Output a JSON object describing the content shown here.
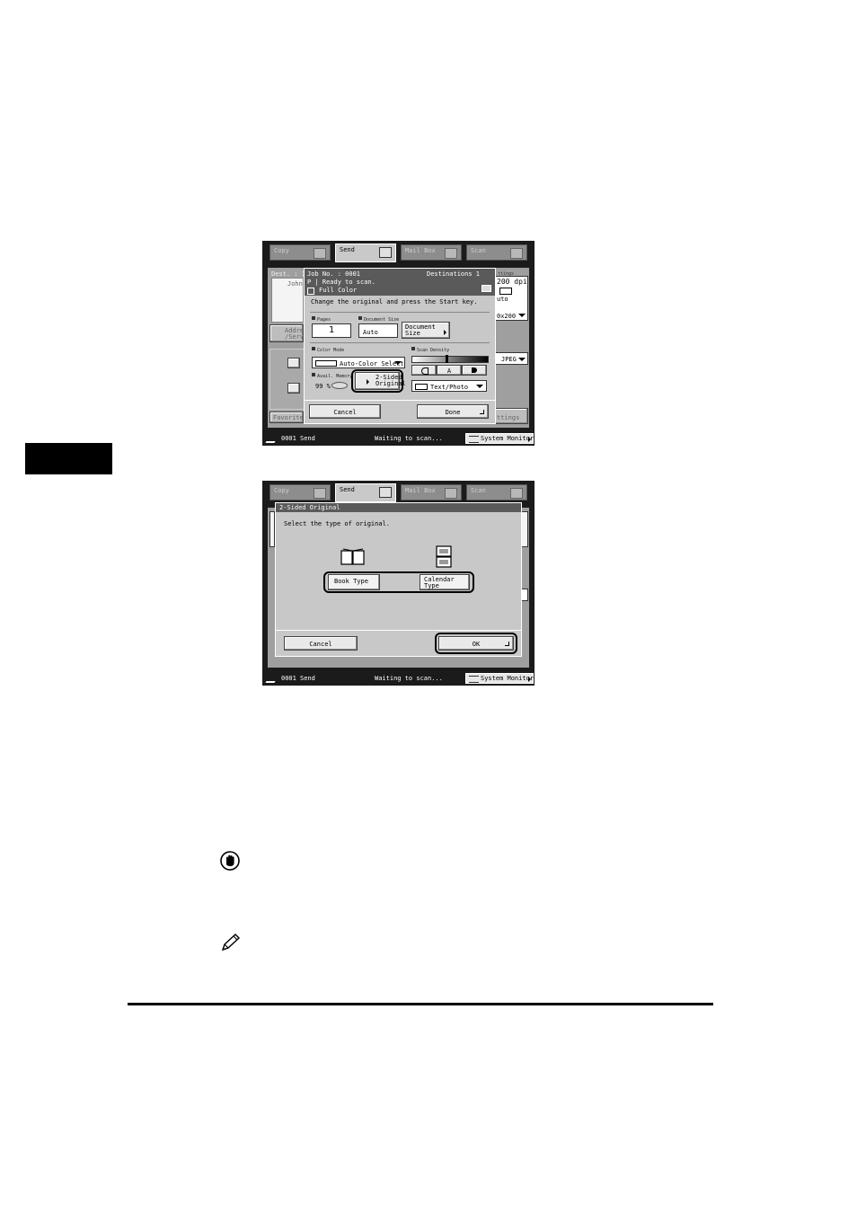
{
  "page": {
    "tab_color": "#000000"
  },
  "screen1": {
    "tabs": [
      "Copy",
      "Send",
      "Mail Box",
      "Scan"
    ],
    "bg_fragments": {
      "dest": "Dest. :  1",
      "dest_name": "John",
      "addr": "Addre",
      "serv": "/Serv",
      "favorites": "Favorites",
      "settings": "ttings",
      "dpi": "200 dpi",
      "auto": "uto",
      "res": "0x200",
      "jpeg": "JPEG",
      "ttings_btn": "ttings"
    },
    "dialog": {
      "job_no": "Job No. :  0001",
      "destinations": "Destinations  1",
      "status": "P  |  Ready to scan.",
      "color": "Full Color",
      "instruction": "Change the original and press the Start key.",
      "pages_label": "Pages",
      "pages_value": "1",
      "docsize_label": "Document Size",
      "docsize_value": "Auto",
      "docsize_button_1": "Document",
      "docsize_button_2": "Size",
      "color_mode_label": "Color Mode",
      "color_mode_value": "Auto-Color Select",
      "avail_memory_label": "Avail. Memory",
      "memory_value": "99 %",
      "two_sided_1": "2-Sided",
      "two_sided_2": "Original",
      "scan_density_label": "Scan Density",
      "density_center": "A",
      "image_type_value": "Text/Photo",
      "cancel": "Cancel",
      "done": "Done"
    },
    "status_bar": {
      "job": "0001",
      "mode": "Send",
      "message": "Waiting to scan...",
      "system_monitor": "System Monitor"
    }
  },
  "screen2": {
    "tabs": [
      "Copy",
      "Send",
      "Mail Box",
      "Scan"
    ],
    "dialog": {
      "title": "2-Sided Original",
      "instruction": "Select the type of original.",
      "book_type": "Book Type",
      "calendar_type_1": "Calendar",
      "calendar_type_2": "Type",
      "cancel": "Cancel",
      "ok": "OK"
    },
    "status_bar": {
      "job": "0001",
      "mode": "Send",
      "message": "Waiting to scan...",
      "system_monitor": "System Monitor"
    }
  },
  "icons": {
    "caution": "caution-hand-icon",
    "note": "note-pencil-icon"
  }
}
